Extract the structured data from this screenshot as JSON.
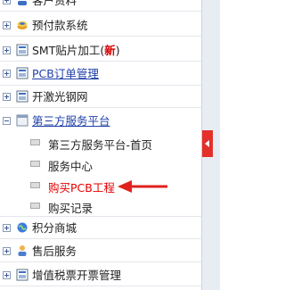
{
  "menu": {
    "items": [
      {
        "label": "客户资料",
        "icon": "customer-icon"
      },
      {
        "label": "预付款系统",
        "icon": "coins-icon"
      },
      {
        "label": "SMT贴片加工",
        "badge": "新",
        "icon": "app-icon"
      },
      {
        "label": "PCB订单管理",
        "icon": "app-icon"
      },
      {
        "label": "开激光钢网",
        "icon": "app-icon"
      },
      {
        "label": "第三方服务平台",
        "icon": "window-icon"
      },
      {
        "label": "积分商城",
        "icon": "globe-icon"
      },
      {
        "label": "售后服务",
        "icon": "person-icon"
      },
      {
        "label": "增值税票开票管理",
        "icon": "app-icon"
      }
    ],
    "submenu": [
      {
        "label": "第三方服务平台-首页"
      },
      {
        "label": "服务中心"
      },
      {
        "label": "购买PCB工程"
      },
      {
        "label": "购买记录"
      }
    ]
  },
  "colors": {
    "link": "#1f3fa8",
    "new_badge": "#d40000",
    "highlight": "#e60000",
    "collapse_tab": "#e3302a"
  }
}
